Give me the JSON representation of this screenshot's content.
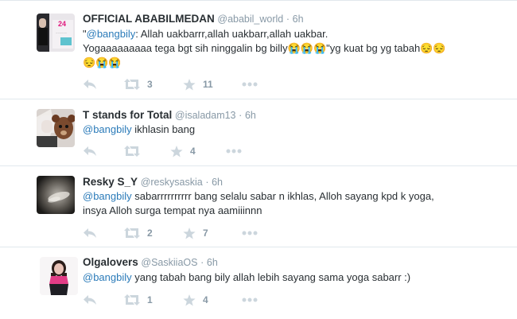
{
  "tweets": [
    {
      "fullname": "OFFICIAL ABABILMEDAN",
      "username": "@ababil_world",
      "sep": "·",
      "time": "6h",
      "line1_pre": "\"",
      "mention": "@bangbily",
      "line1_rest": ": Allah uakbarrr,allah uakbarr,allah uakbar.",
      "line2": "Yogaaaaaaaaa tega bgt sih ninggalin bg billy😭😭😭\"yg kuat bg yg tabah😔😔",
      "line3": "😔😭😭",
      "retweets": "3",
      "favorites": "11"
    },
    {
      "fullname": "T stands for Total",
      "username": "@isaladam13",
      "sep": "·",
      "time": "6h",
      "mention": "@bangbily",
      "text": " ikhlasin bang",
      "retweets": "",
      "favorites": "4"
    },
    {
      "fullname": "Resky S_Y",
      "username": "@reskysaskia",
      "sep": "·",
      "time": "6h",
      "mention": "@bangbily",
      "text": " sabarrrrrrrrrr bang selalu sabar n ikhlas, Alloh sayang kpd k yoga,",
      "line2": "insya Alloh surga tempat nya aamiiinnn",
      "retweets": "2",
      "favorites": "7"
    },
    {
      "fullname": "Olgalovers",
      "username": "@SaskiiaOS",
      "sep": "·",
      "time": "6h",
      "mention": "@bangbily",
      "text": " yang tabah bang bily allah lebih sayang sama yoga sabarr :)",
      "retweets": "1",
      "favorites": "4"
    }
  ],
  "avatar1_text": "24",
  "colors": {
    "link": "#2b7bb9",
    "meta": "#8899a6",
    "icon": "#ccd6dd",
    "border": "#e1e8ed"
  },
  "icons": [
    "reply-icon",
    "retweet-icon",
    "favorite-star-icon",
    "more-dots-icon"
  ]
}
